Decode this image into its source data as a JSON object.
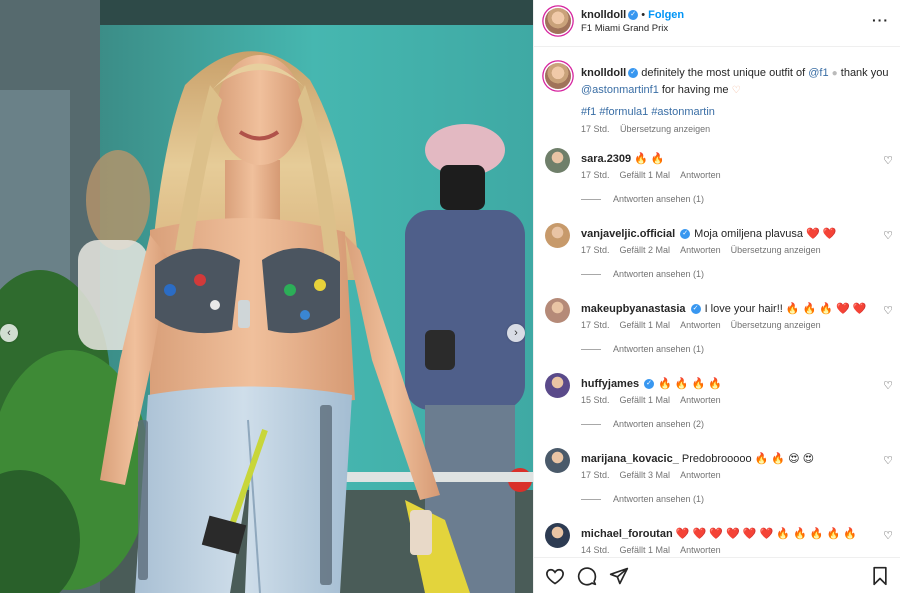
{
  "post": {
    "username": "knolldoll",
    "follow_label": "Folgen",
    "location": "F1 Miami Grand Prix",
    "caption": {
      "username": "knolldoll",
      "text_1": "definitely the most unique outfit of",
      "mention_1": "@f1",
      "text_2": "thank you",
      "mention_2": "@astonmartinf1",
      "text_3": "for having me",
      "hashtags": "#f1 #formula1 #astonmartin",
      "time": "17 Std.",
      "translate": "Übersetzung anzeigen"
    }
  },
  "comments": [
    {
      "username": "sara.2309",
      "text": "",
      "emojis": "🔥 🔥",
      "time": "17 Std.",
      "likes": "Gefällt 1 Mal",
      "reply": "Antworten",
      "translate": "",
      "replies": "Antworten ansehen (1)",
      "avatar_color": "#6f7f6a"
    },
    {
      "username": "vanjaveljic.official",
      "verified": true,
      "text": "Moja omiljena plavusa",
      "emojis": "❤️ ❤️",
      "time": "17 Std.",
      "likes": "Gefällt 2 Mal",
      "reply": "Antworten",
      "translate": "Übersetzung anzeigen",
      "replies": "Antworten ansehen (1)",
      "avatar_color": "#c79a6b"
    },
    {
      "username": "makeupbyanastasia",
      "verified": true,
      "text": "I love your hair!!",
      "emojis": "🔥 🔥 🔥 ❤️ ❤️",
      "time": "17 Std.",
      "likes": "Gefällt 1 Mal",
      "reply": "Antworten",
      "translate": "Übersetzung anzeigen",
      "replies": "Antworten ansehen (1)",
      "avatar_color": "#b58a78"
    },
    {
      "username": "huffyjames",
      "verified": true,
      "text": "",
      "emojis": "🔥 🔥 🔥 🔥",
      "time": "15 Std.",
      "likes": "Gefällt 1 Mal",
      "reply": "Antworten",
      "translate": "",
      "replies": "Antworten ansehen (2)",
      "avatar_color": "#5a4a8a"
    },
    {
      "username": "marijana_kovacic_",
      "text": "Predobrooooo",
      "emojis": "🔥 🔥 😍 😍",
      "time": "17 Std.",
      "likes": "Gefällt 3 Mal",
      "reply": "Antworten",
      "translate": "",
      "replies": "Antworten ansehen (1)",
      "avatar_color": "#4a5a6a"
    },
    {
      "username": "michael_foroutan",
      "text": "",
      "emojis": "❤️ ❤️ ❤️ ❤️ ❤️ ❤️ 🔥 🔥 🔥 🔥 🔥",
      "time": "14 Std.",
      "likes": "Gefällt 1 Mal",
      "reply": "Antworten",
      "translate": "",
      "replies": "",
      "avatar_color": "#2d3b52"
    }
  ],
  "icons": {
    "like": "heart-outline-icon",
    "comment": "comment-bubble-icon",
    "share": "paper-plane-icon",
    "save": "bookmark-icon",
    "more": "more-options-icon",
    "prev": "chevron-left-icon",
    "next": "chevron-right-icon"
  },
  "colors": {
    "link": "#0095f6",
    "mention": "#3a6ea5",
    "verified": "#3897f0",
    "meta": "#737373"
  }
}
